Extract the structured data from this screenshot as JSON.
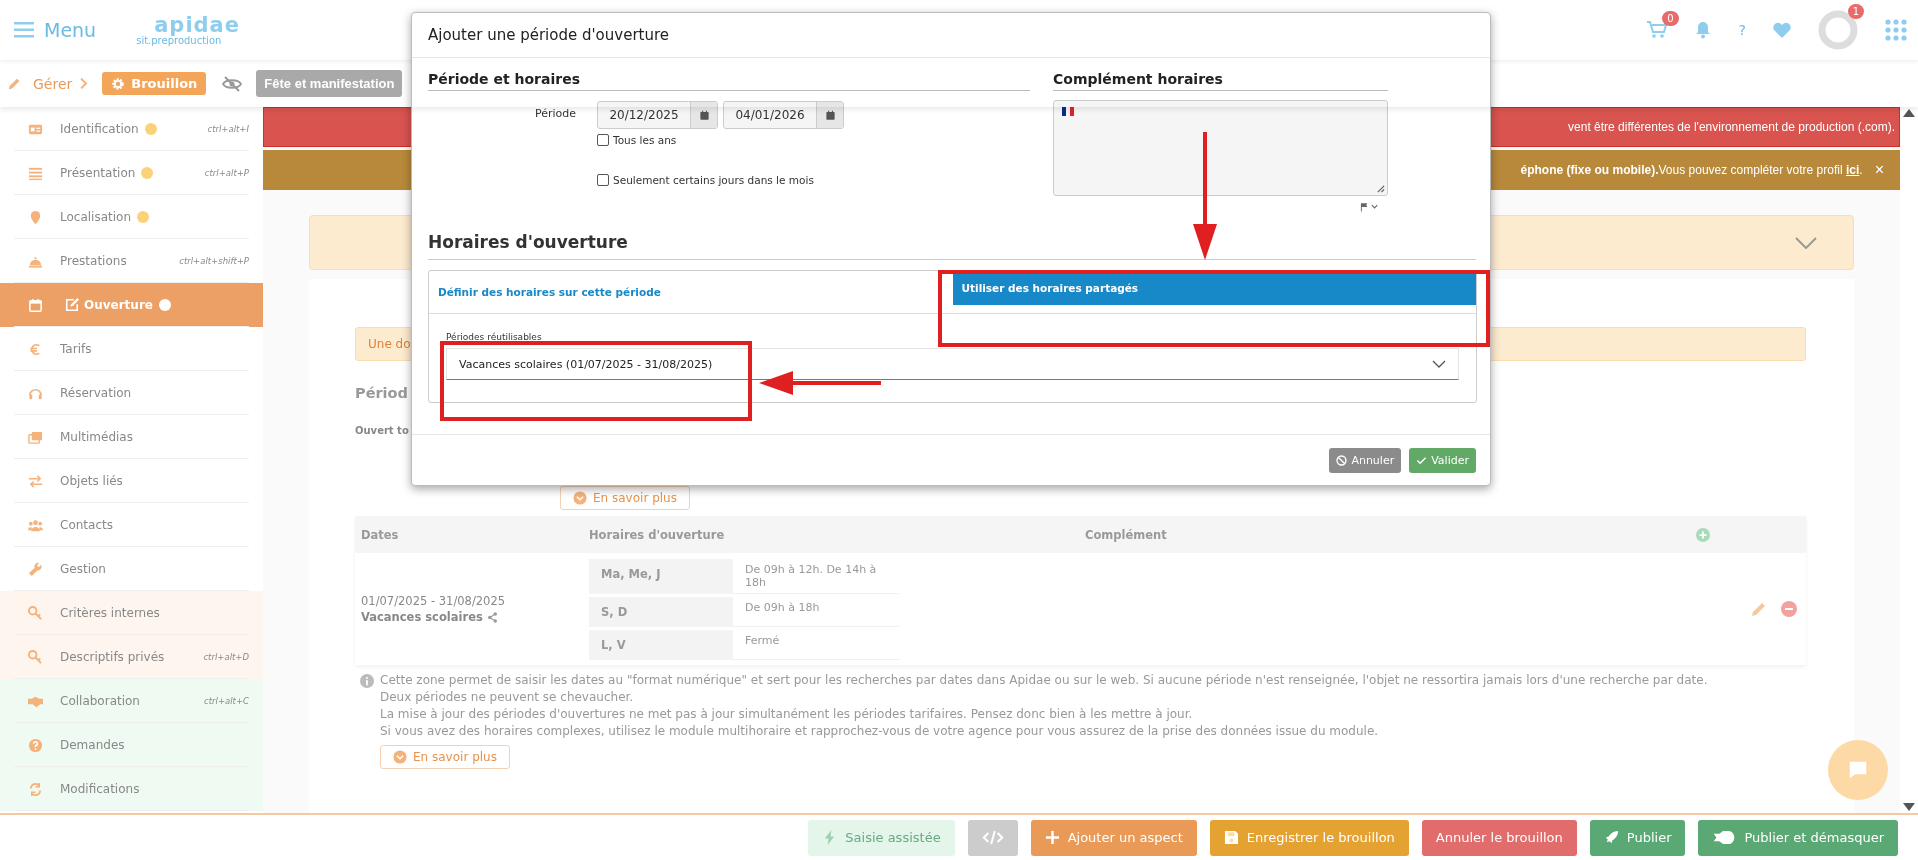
{
  "header": {
    "menu_label": "Menu",
    "logo": "apidae",
    "logo_subtitle": "sit.preproduction",
    "cart_count": "0",
    "help": "?",
    "avatar_badge": "1"
  },
  "toolbar": {
    "manage": "Gérer",
    "status": "Brouillon",
    "type": "Fête et manifestation"
  },
  "sidebar": {
    "items": [
      {
        "label": "Identification",
        "warning": true,
        "shortcut": "ctrl+alt+I",
        "selected": false,
        "kind": "standard"
      },
      {
        "label": "Présentation",
        "warning": true,
        "shortcut": "ctrl+alt+P",
        "selected": false,
        "kind": "standard"
      },
      {
        "label": "Localisation",
        "warning": true,
        "selected": false,
        "kind": "standard"
      },
      {
        "label": "Prestations",
        "warning": false,
        "shortcut": "ctrl+alt+shift+P",
        "selected": false,
        "kind": "standard"
      },
      {
        "label": "Ouverture",
        "warning": true,
        "selected": true,
        "kind": "standard"
      },
      {
        "label": "Tarifs",
        "warning": false,
        "selected": false,
        "kind": "standard"
      },
      {
        "label": "Réservation",
        "warning": false,
        "selected": false,
        "kind": "standard"
      },
      {
        "label": "Multimédias",
        "warning": false,
        "selected": false,
        "kind": "standard"
      },
      {
        "label": "Objets liés",
        "warning": false,
        "selected": false,
        "kind": "standard"
      },
      {
        "label": "Contacts",
        "warning": false,
        "selected": false,
        "kind": "standard"
      },
      {
        "label": "Gestion",
        "warning": false,
        "selected": false,
        "kind": "standard"
      },
      {
        "label": "Critères internes",
        "warning": false,
        "selected": false,
        "kind": "private"
      },
      {
        "label": "Descriptifs privés",
        "warning": false,
        "shortcut": "ctrl+alt+D",
        "selected": false,
        "kind": "private"
      },
      {
        "label": "Collaboration",
        "warning": false,
        "shortcut": "ctrl+alt+C",
        "selected": false,
        "kind": "collab"
      },
      {
        "label": "Demandes",
        "warning": false,
        "selected": false,
        "kind": "collab"
      },
      {
        "label": "Modifications",
        "warning": false,
        "selected": false,
        "kind": "collab"
      }
    ]
  },
  "alerts": [
    {
      "kind": "error",
      "text": "vent être différentes de l'environnement de production (.com)."
    },
    {
      "kind": "warning",
      "text": "**éphone (fixe ou mobile).**Vous pouvez compléter votre profil ",
      "link": "ici",
      "after": ".",
      "close": "×"
    }
  ],
  "content": {
    "notice": "Une do",
    "section_title": "Périod",
    "open_label": "Ouvert to",
    "more_button": "En savoir plus",
    "table": {
      "columns": [
        "Dates",
        "Horaires d'ouverture",
        "Complément"
      ],
      "rows": [
        {
          "dates": "01/07/2025 - 31/08/2025",
          "name": "Vacances scolaires",
          "shared": true,
          "schedule": [
            {
              "days": "Ma, Me, J",
              "hours": "De 09h à 12h. De 14h à 18h"
            },
            {
              "days": "S, D",
              "hours": "De 09h à 18h"
            },
            {
              "days": "L, V",
              "hours": "Fermé"
            }
          ]
        }
      ]
    },
    "info": {
      "lines": [
        "Cette zone permet de saisir les dates au \"format numérique\" et sert pour les recherches par dates dans Apidae ou sur le web. Si aucune période n'est renseignée, l'objet ne ressortira jamais lors d'une recherche par date.",
        "Deux périodes ne peuvent se chevaucher.",
        "La mise à jour des périodes d'ouvertures ne met pas à jour simultanément les périodes tarifaires. Pensez donc bien à les mettre à jour.",
        "Si vous avez des horaires complexes, utilisez le module multihoraire et rapprochez-vous de votre agence pour vous assurez de la prise des données issue du module."
      ],
      "more_button": "En savoir plus"
    }
  },
  "bottom_bar": {
    "buttons": [
      {
        "kind": "assist",
        "label": "Saisie assistée"
      },
      {
        "kind": "code"
      },
      {
        "kind": "aspect",
        "label": "Ajouter un aspect"
      },
      {
        "kind": "save",
        "label": "Enregistrer le brouillon"
      },
      {
        "kind": "cancel",
        "label": "Annuler le brouillon"
      },
      {
        "kind": "publish",
        "label": "Publier"
      },
      {
        "kind": "publish_unmask",
        "label": "Publier et démasquer"
      }
    ]
  },
  "modal": {
    "title": "Ajouter une période d'ouverture",
    "period_section": "Période et horaires",
    "period_label": "Période",
    "start_date": "20/12/2025",
    "end_date": "04/01/2026",
    "checkboxes": [
      {
        "label": "Tous les ans",
        "checked": false
      },
      {
        "label": "Seulement certains jours dans le mois",
        "checked": false
      }
    ],
    "complement_section": "Complément horaires",
    "hours_section": "Horaires d'ouverture",
    "tabs": [
      {
        "label": "Définir des horaires sur cette période",
        "selected": false
      },
      {
        "label": "Utiliser des horaires partagés",
        "selected": true
      }
    ],
    "select_label": "Périodes réutilisables",
    "select_value": "Vacances scolaires (01/07/2025 - 31/08/2025)",
    "buttons": [
      {
        "kind": "cancel",
        "label": "Annuler"
      },
      {
        "kind": "confirm",
        "label": "Valider"
      }
    ]
  }
}
